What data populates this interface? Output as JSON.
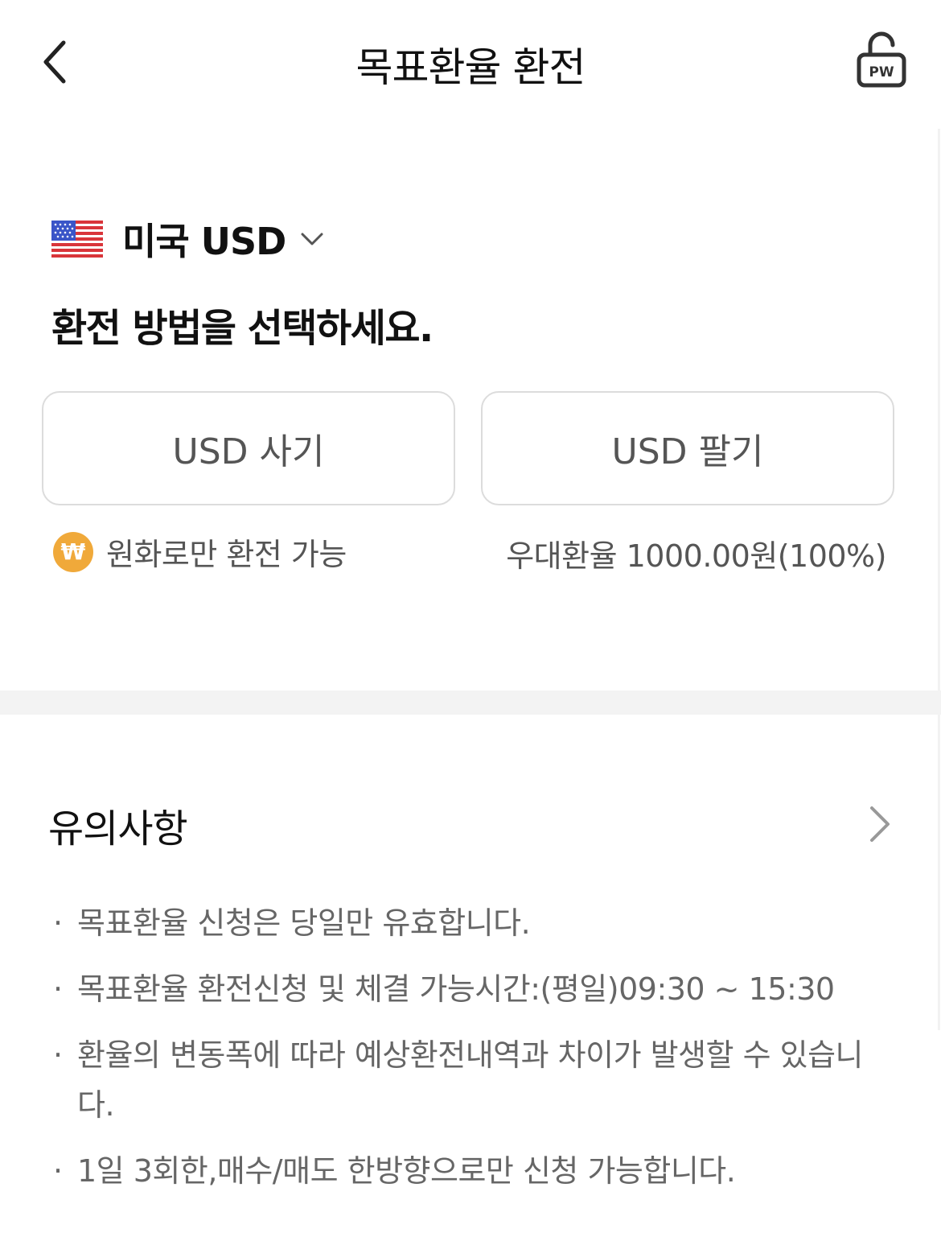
{
  "header": {
    "title": "목표환율 환전",
    "back_icon": "chevron-left-icon",
    "lock_icon": "password-lock-icon",
    "lock_label": "PW"
  },
  "currency": {
    "label": "미국 USD",
    "flag": "us-flag-icon"
  },
  "prompt": "환전 방법을 선택하세요.",
  "actions": {
    "buy_label": "USD 사기",
    "sell_label": "USD 팔기"
  },
  "notes": {
    "won_symbol": "₩",
    "won_only": "원화로만 환전 가능",
    "preferential_rate": "우대환율 1000.00원(100%)"
  },
  "notice": {
    "title": "유의사항",
    "items": [
      "목표환율 신청은 당일만 유효합니다.",
      "목표환율 환전신청 및 체결 가능시간:(평일)09:30 ~ 15:30",
      "환율의 변동폭에 따라 예상환전내역과 차이가 발생할 수 있습니다.",
      "1일 3회한,매수/매도 한방향으로만 신청 가능합니다."
    ]
  },
  "colors": {
    "accent_won": "#f0a93a",
    "band": "#f3f3f3",
    "border": "#dcdcdc"
  }
}
